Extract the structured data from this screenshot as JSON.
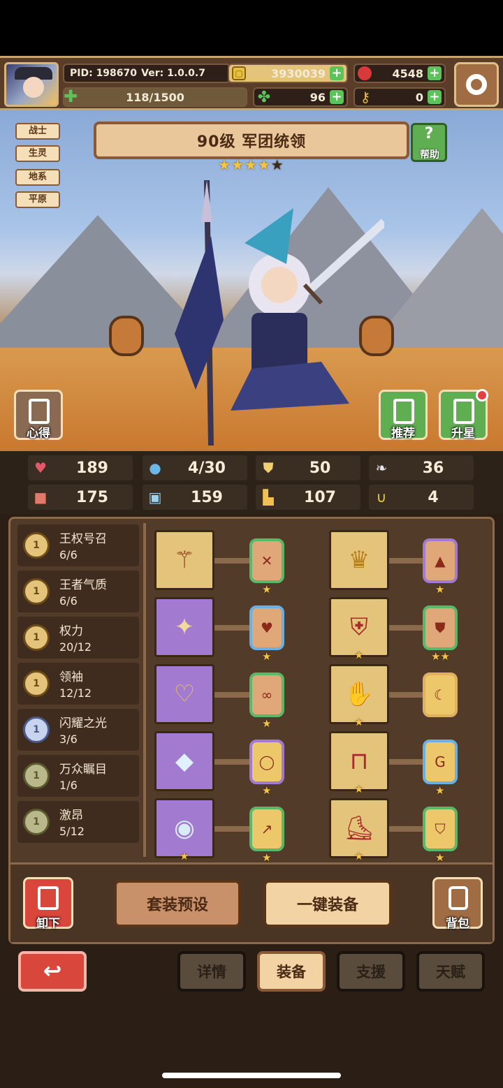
{
  "header": {
    "pid": "PID: 198670",
    "version": "Ver: 1.0.0.7",
    "gold": "3930039",
    "gems": "4548",
    "energy": "118/1500",
    "clover": "96",
    "keys": "0"
  },
  "class_tags": [
    "战士",
    "生灵",
    "地系",
    "平原"
  ],
  "hero": {
    "title": "90级  军团统领",
    "stars": 4,
    "max_stars": 5,
    "help_label": "帮助",
    "left_button_label": "心得",
    "recommend_label": "推荐",
    "upgrade_star_label": "升星"
  },
  "stats": [
    {
      "icon": "heart-icon",
      "value": "189"
    },
    {
      "icon": "drop-icon",
      "value": "4/30"
    },
    {
      "icon": "shield-icon",
      "value": "50"
    },
    {
      "icon": "wing-icon",
      "value": "36"
    },
    {
      "icon": "fist-icon",
      "value": "175"
    },
    {
      "icon": "book-icon",
      "value": "159"
    },
    {
      "icon": "boot-icon",
      "value": "107"
    },
    {
      "icon": "horseshoe-icon",
      "value": "4"
    }
  ],
  "sets": [
    {
      "name": "王权号召",
      "count": "6/6",
      "coin": "gold"
    },
    {
      "name": "王者气质",
      "count": "6/6",
      "coin": "gold"
    },
    {
      "name": "权力",
      "count": "20/12",
      "coin": "gold"
    },
    {
      "name": "领袖",
      "count": "12/12",
      "coin": "gold"
    },
    {
      "name": "闪耀之光",
      "count": "3/6",
      "coin": "silver"
    },
    {
      "name": "万众瞩目",
      "count": "1/6",
      "coin": "olive"
    },
    {
      "name": "激昂",
      "count": "5/12",
      "coin": "olive"
    }
  ],
  "actions": {
    "unequip": "卸下",
    "preset": "套装预设",
    "auto_equip": "一键装备",
    "bag": "背包"
  },
  "tabs": [
    "详情",
    "装备",
    "支援",
    "天赋"
  ],
  "active_tab": "装备",
  "colors": {
    "panel": "#533b2a",
    "accent_gold": "#e4c37a",
    "accent_purple": "#a27ad0",
    "danger": "#d9463c"
  }
}
